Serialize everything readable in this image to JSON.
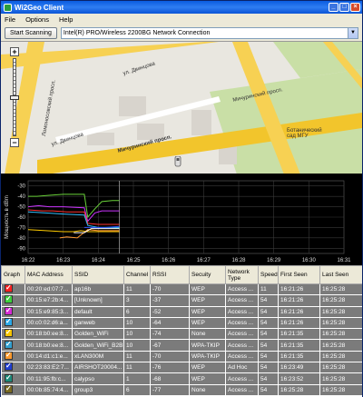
{
  "window": {
    "title": "Wi2Geo Client"
  },
  "menu": {
    "file": "File",
    "options": "Options",
    "help": "Help"
  },
  "toolbar": {
    "start_scanning": "Start Scanning",
    "adapter": "Intel(R) PRO/Wireless 2200BG Network Connection"
  },
  "map": {
    "labels": {
      "ul_dvintsova_top": "ул. Двинцова",
      "ul_dvintsova_left": "ул. Двинцова",
      "mikhrinsky_pr": "Мичуринский просп.",
      "botanic_garden": "Ботанический\nсад МГУ",
      "michurinsky_upper": "Мичуринский просп.",
      "left_road": "Ломоносовский просп."
    },
    "colors": {
      "road": "#f7d153",
      "major_road": "#f2c52c",
      "park": "#c9dfa6",
      "block": "#d8d4cd"
    }
  },
  "chart": {
    "ylabel": "Мощность в dBm",
    "yticks": [
      "-30",
      "-40",
      "-50",
      "-60",
      "-70",
      "-80",
      "-90"
    ],
    "xticks": [
      "16:22",
      "16:23",
      "16:24",
      "16:25",
      "16:26",
      "16:27",
      "16:28",
      "16:29",
      "16:30",
      "16:31"
    ]
  },
  "chart_data": {
    "type": "line",
    "title": "",
    "xlabel": "",
    "ylabel": "Мощность в dBm",
    "ylim": [
      -95,
      -25
    ],
    "x": [
      "16:22",
      "16:23",
      "16:24",
      "16:25",
      "16:26",
      "16:27",
      "16:28",
      "16:29",
      "16:30",
      "16:31"
    ],
    "grid": true,
    "series": [
      {
        "color": "#6ad23a",
        "points": [
          [
            0,
            -40
          ],
          [
            0.25,
            -40
          ],
          [
            0.6,
            -39
          ],
          [
            1.0,
            -38
          ],
          [
            1.6,
            -38
          ],
          [
            1.7,
            -60
          ],
          [
            1.9,
            -52
          ],
          [
            2.1,
            -45
          ],
          [
            2.4,
            -44
          ],
          [
            2.6,
            -44
          ]
        ]
      },
      {
        "color": "#cc33ff",
        "points": [
          [
            0,
            -50
          ],
          [
            0.3,
            -49
          ],
          [
            0.6,
            -50
          ],
          [
            1.0,
            -50
          ],
          [
            1.6,
            -51
          ],
          [
            1.7,
            -64
          ],
          [
            1.9,
            -56
          ],
          [
            2.1,
            -54
          ],
          [
            2.6,
            -54
          ]
        ]
      },
      {
        "color": "#ff3333",
        "points": [
          [
            0,
            -53
          ],
          [
            0.4,
            -54
          ],
          [
            0.7,
            -54
          ],
          [
            1.1,
            -55
          ],
          [
            1.6,
            -55
          ],
          [
            1.7,
            -66
          ],
          [
            2.0,
            -67
          ],
          [
            2.6,
            -67
          ]
        ]
      },
      {
        "color": "#33c1ff",
        "points": [
          [
            0,
            -55
          ],
          [
            0.5,
            -56
          ],
          [
            1.0,
            -57
          ],
          [
            1.6,
            -58
          ],
          [
            1.7,
            -68
          ],
          [
            2.0,
            -70
          ],
          [
            2.6,
            -70
          ]
        ]
      },
      {
        "color": "#ffcc00",
        "points": [
          [
            0,
            -72
          ],
          [
            0.5,
            -73
          ],
          [
            1.0,
            -74
          ],
          [
            1.3,
            -74
          ],
          [
            1.5,
            -73
          ],
          [
            1.7,
            -74
          ],
          [
            2.0,
            -74
          ],
          [
            2.6,
            -74
          ]
        ]
      },
      {
        "color": "#ff9933",
        "points": [
          [
            0.9,
            -80
          ],
          [
            1.1,
            -79
          ],
          [
            1.4,
            -80
          ],
          [
            1.7,
            -72
          ],
          [
            2.0,
            -73
          ],
          [
            2.6,
            -73
          ]
        ]
      },
      {
        "color": "#ffffff",
        "points": [
          [
            1.3,
            -75
          ],
          [
            1.6,
            -75
          ],
          [
            1.8,
            -71
          ],
          [
            2.1,
            -71
          ],
          [
            2.6,
            -71
          ]
        ]
      },
      {
        "color": "#3355ff",
        "points": [
          [
            1.6,
            -70
          ],
          [
            1.8,
            -70
          ],
          [
            2.2,
            -70
          ],
          [
            2.6,
            -69
          ]
        ]
      }
    ]
  },
  "table": {
    "headers": [
      "Graph",
      "MAC Address",
      "SSID",
      "Channel",
      "RSSI",
      "Secuity",
      "Network Type",
      "Speed",
      "First Seen",
      "Last Seen"
    ],
    "rows": [
      {
        "color": "#ff2020",
        "mac": "00:20:ed:07:7...",
        "ssid": "ap16b",
        "channel": "11",
        "rssi": "-70",
        "security": "WEP",
        "type": "Access ...",
        "speed": "11",
        "first": "16:21:26",
        "last": "16:25:28"
      },
      {
        "color": "#3cd23c",
        "mac": "00:15:e7:2b:4...",
        "ssid": "[Unknown]",
        "channel": "3",
        "rssi": "-37",
        "security": "WEP",
        "type": "Access ...",
        "speed": "54",
        "first": "16:21:26",
        "last": "16:25:28"
      },
      {
        "color": "#d629d6",
        "mac": "00:15:e9:85:3...",
        "ssid": "default",
        "channel": "6",
        "rssi": "-52",
        "security": "WEP",
        "type": "Access ...",
        "speed": "54",
        "first": "16:21:26",
        "last": "16:25:28"
      },
      {
        "color": "#2aa8e8",
        "mac": "00:c0:02:d6:a...",
        "ssid": "ganweb",
        "channel": "10",
        "rssi": "-64",
        "security": "WEP",
        "type": "Access ...",
        "speed": "54",
        "first": "16:21:26",
        "last": "16:25:28"
      },
      {
        "color": "#f5c400",
        "mac": "00:18:b0:ee:8...",
        "ssid": "Golden_WiFi",
        "channel": "10",
        "rssi": "-74",
        "security": "None",
        "type": "Access ...",
        "speed": "54",
        "first": "16:21:35",
        "last": "16:25:28"
      },
      {
        "color": "#33a0d0",
        "mac": "00:18:b0:ee:8...",
        "ssid": "Golden_WiFi_B2B",
        "channel": "10",
        "rssi": "-67",
        "security": "WPA-TKIP",
        "type": "Access ...",
        "speed": "54",
        "first": "16:21:35",
        "last": "16:25:28"
      },
      {
        "color": "#ff9a2e",
        "mac": "00:14:d1:c1:e...",
        "ssid": "xLAN300M",
        "channel": "11",
        "rssi": "-70",
        "security": "WPA-TKIP",
        "type": "Access ...",
        "speed": "54",
        "first": "16:21:35",
        "last": "16:25:28"
      },
      {
        "color": "#1f3ed0",
        "mac": "02:23:83:E2:7...",
        "ssid": "AIRSHOT20004...",
        "channel": "11",
        "rssi": "-76",
        "security": "WEP",
        "type": "Ad Hoc",
        "speed": "54",
        "first": "16:23:49",
        "last": "16:25:28"
      },
      {
        "color": "#1c8a7a",
        "mac": "00:11:95:fb:c...",
        "ssid": "calypso",
        "channel": "1",
        "rssi": "-68",
        "security": "WEP",
        "type": "Access ...",
        "speed": "54",
        "first": "16:23:52",
        "last": "16:25:28"
      },
      {
        "color": "#7a6a20",
        "mac": "00:0b:85:74:4...",
        "ssid": "group3",
        "channel": "6",
        "rssi": "-77",
        "security": "None",
        "type": "Access ...",
        "speed": "54",
        "first": "16:25:28",
        "last": "16:25:28"
      }
    ]
  }
}
